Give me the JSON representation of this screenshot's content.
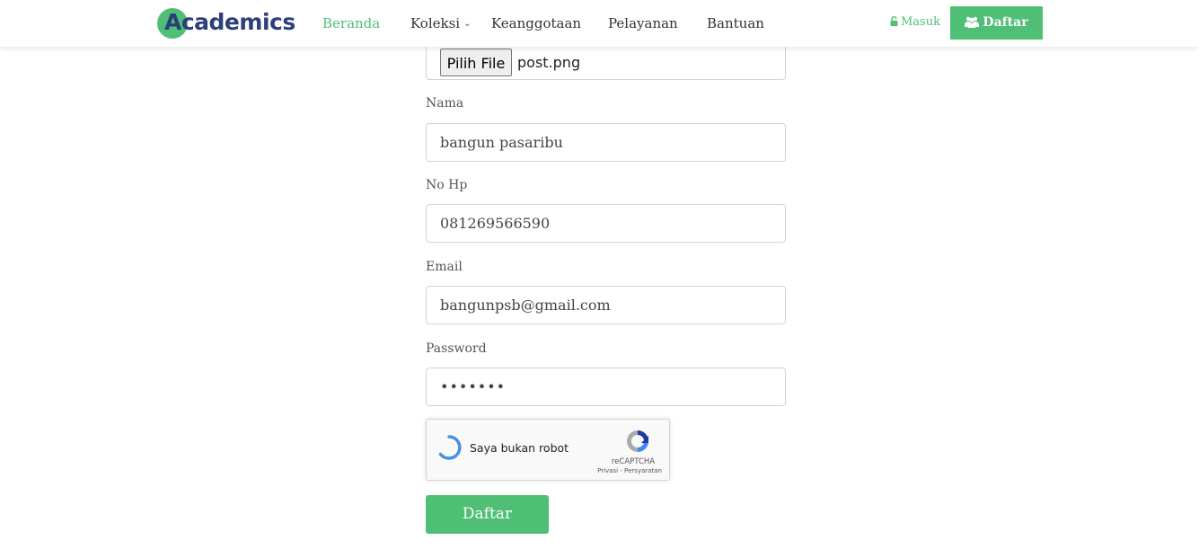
{
  "header": {
    "logo_text": "Academics",
    "nav": {
      "beranda": "Beranda",
      "koleksi": "Koleksi",
      "keanggotaan": "Keanggotaan",
      "pelayanan": "Pelayanan",
      "bantuan": "Bantuan"
    },
    "login_label": "Masuk",
    "register_label": "Daftar"
  },
  "form": {
    "file": {
      "button_label": "Pilih File",
      "file_name": "post.png"
    },
    "nama": {
      "label": "Nama",
      "value": "bangun pasaribu"
    },
    "no_hp": {
      "label": "No Hp",
      "value": "081269566590"
    },
    "email": {
      "label": "Email",
      "value": "bangunpsb@gmail.com"
    },
    "password": {
      "label": "Password",
      "value": "•••••••"
    },
    "recaptcha": {
      "label": "Saya bukan robot",
      "brand": "reCAPTCHA",
      "links": "Privasi - Persyaratan"
    },
    "submit_label": "Daftar"
  },
  "colors": {
    "accent": "#4fbf76",
    "logo_text": "#2d3f7a"
  },
  "icons": {
    "login": "lock-icon",
    "register": "users-icon",
    "dropdown": "chevron-down-icon",
    "recaptcha_spinner": "spinner-icon",
    "recaptcha_logo": "recaptcha-logo-icon"
  }
}
